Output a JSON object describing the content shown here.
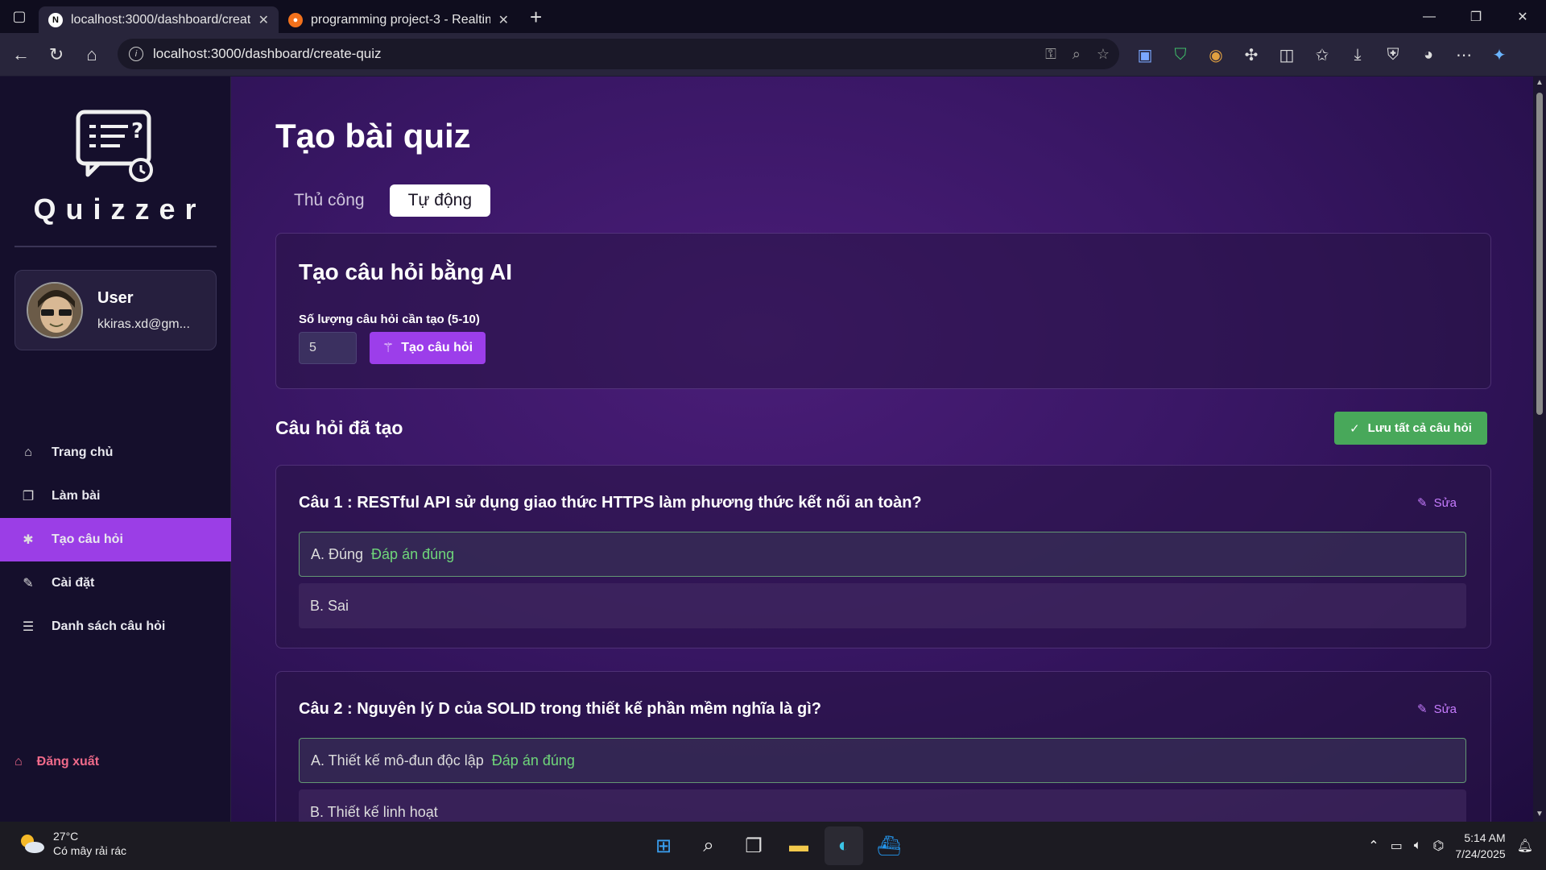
{
  "browser": {
    "tabs": [
      {
        "title": "localhost:3000/dashboard/create-",
        "active": true
      },
      {
        "title": "programming project-3 - Realtim",
        "active": false
      }
    ],
    "url": "localhost:3000/dashboard/create-quiz"
  },
  "sidebar": {
    "brand": "Quizzer",
    "user": {
      "name": "User",
      "email": "kkiras.xd@gm..."
    },
    "items": [
      {
        "label": "Trang chủ",
        "icon": "home-icon"
      },
      {
        "label": "Làm bài",
        "icon": "file-icon"
      },
      {
        "label": "Tạo câu hỏi",
        "icon": "create-icon",
        "active": true
      },
      {
        "label": "Cài đặt",
        "icon": "wrench-icon"
      },
      {
        "label": "Danh sách câu hỏi",
        "icon": "list-icon"
      }
    ],
    "logout": "Đăng xuất"
  },
  "main": {
    "title": "Tạo bài quiz",
    "tabs": [
      {
        "label": "Thủ công",
        "active": false
      },
      {
        "label": "Tự động",
        "active": true
      }
    ],
    "ai_card": {
      "title": "Tạo câu hỏi bằng AI",
      "count_label": "Số lượng câu hỏi cần tạo (5-10)",
      "count_value": "5",
      "generate_button": "Tạo câu hỏi"
    },
    "generated_title": "Câu hỏi đã tạo",
    "save_all_button": "Lưu tất cả câu hỏi",
    "edit_label": "Sửa",
    "correct_tag": "Đáp án đúng",
    "questions": [
      {
        "text": "Câu 1 : RESTful API sử dụng giao thức HTTPS làm phương thức kết nối an toàn?",
        "options": [
          {
            "label": "A. Đúng",
            "correct": true
          },
          {
            "label": "B. Sai",
            "correct": false
          }
        ]
      },
      {
        "text": "Câu 2 : Nguyên lý D của SOLID trong thiết kế phần mềm nghĩa là gì?",
        "options": [
          {
            "label": "A. Thiết kế mô-đun độc lập",
            "correct": true
          },
          {
            "label": "B. Thiết kế linh hoạt",
            "correct": false
          }
        ]
      }
    ]
  },
  "taskbar": {
    "weather": {
      "temp": "27°C",
      "desc": "Có mây rải rác"
    },
    "time": "5:14 AM",
    "date": "7/24/2025"
  },
  "colors": {
    "accent": "#9c3eea",
    "success": "#48a85a",
    "logout": "#f06a8a"
  }
}
